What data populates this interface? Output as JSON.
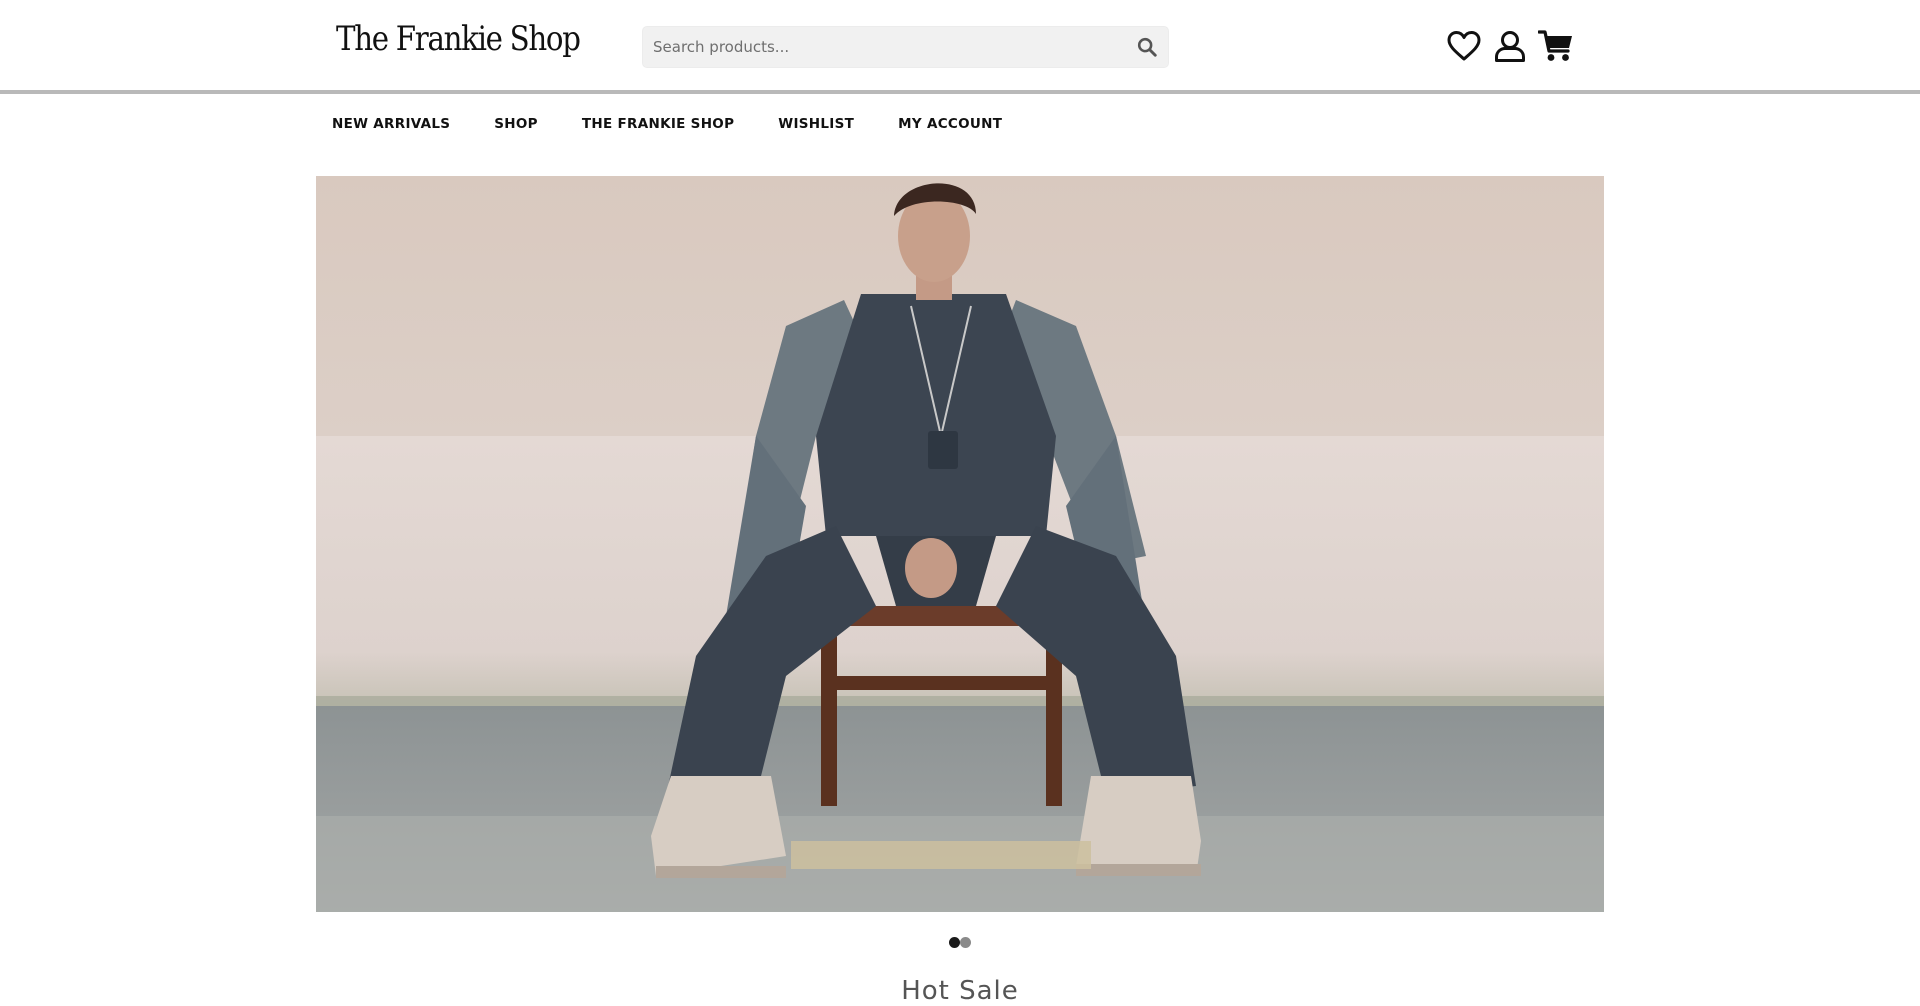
{
  "header": {
    "logo_text": "The Frankie Shop",
    "search": {
      "placeholder": "Search products...",
      "value": ""
    },
    "icons": [
      "heart-icon",
      "user-icon",
      "cart-icon"
    ]
  },
  "nav": {
    "items": [
      {
        "label": "NEW ARRIVALS"
      },
      {
        "label": "SHOP"
      },
      {
        "label": "THE FRANKIE SHOP"
      },
      {
        "label": "WISHLIST"
      },
      {
        "label": "MY ACCOUNT"
      }
    ]
  },
  "hero": {
    "slides_total": 2,
    "active_slide": 1,
    "image": "Model in oversized grey coat and navy wide-leg suit seated on a wooden chair against a pale wall"
  },
  "section": {
    "title": "Hot Sale"
  },
  "colors": {
    "header_border": "#b9b9b9",
    "search_bg": "#f1f1f1",
    "dot_active": "#1a1a1a",
    "dot_inactive": "#8a8a8a"
  }
}
